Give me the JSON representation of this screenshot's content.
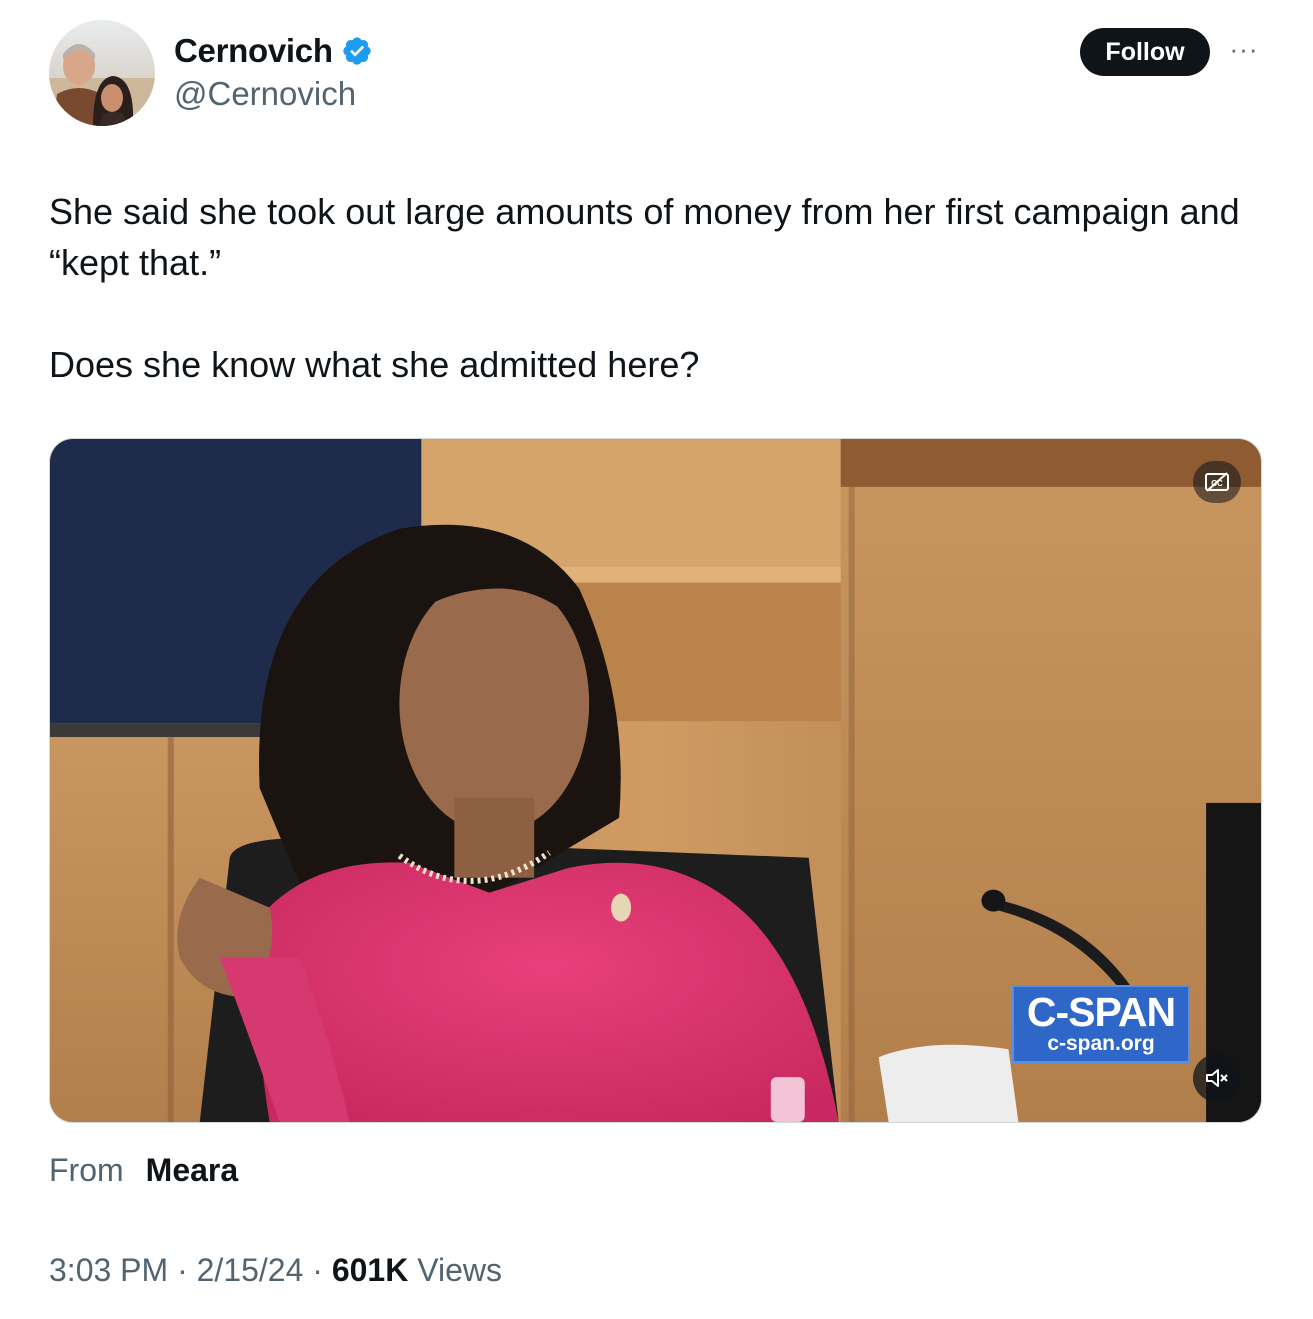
{
  "author": {
    "display_name": "Cernovich",
    "handle": "@Cernovich",
    "verified": true,
    "verified_color": "#1d9bf0",
    "avatar_icon": "profile-photo-couple-beach"
  },
  "header": {
    "follow_label": "Follow",
    "more_icon": "more-dots-icon",
    "more_glyph": "···"
  },
  "tweet": {
    "paragraphs": [
      "She said she took out large amounts of money from her first campaign and “kept that.”",
      "Does she know what she admitted here?"
    ]
  },
  "media": {
    "type": "video",
    "captions_icon": "captions-off-icon",
    "mute_icon": "muted-speaker-icon",
    "watermark": {
      "brand": "C-SPAN",
      "url": "c-span.org"
    }
  },
  "attribution": {
    "from_label": "From",
    "source": "Meara"
  },
  "meta": {
    "time": "3:03 PM",
    "separator": " · ",
    "date": "2/15/24",
    "views_count": "601K",
    "views_label": " Views"
  },
  "colors": {
    "text_primary": "#0f1419",
    "text_secondary": "#536471",
    "follow_bg": "#0f1419",
    "border": "#cfd9de"
  }
}
